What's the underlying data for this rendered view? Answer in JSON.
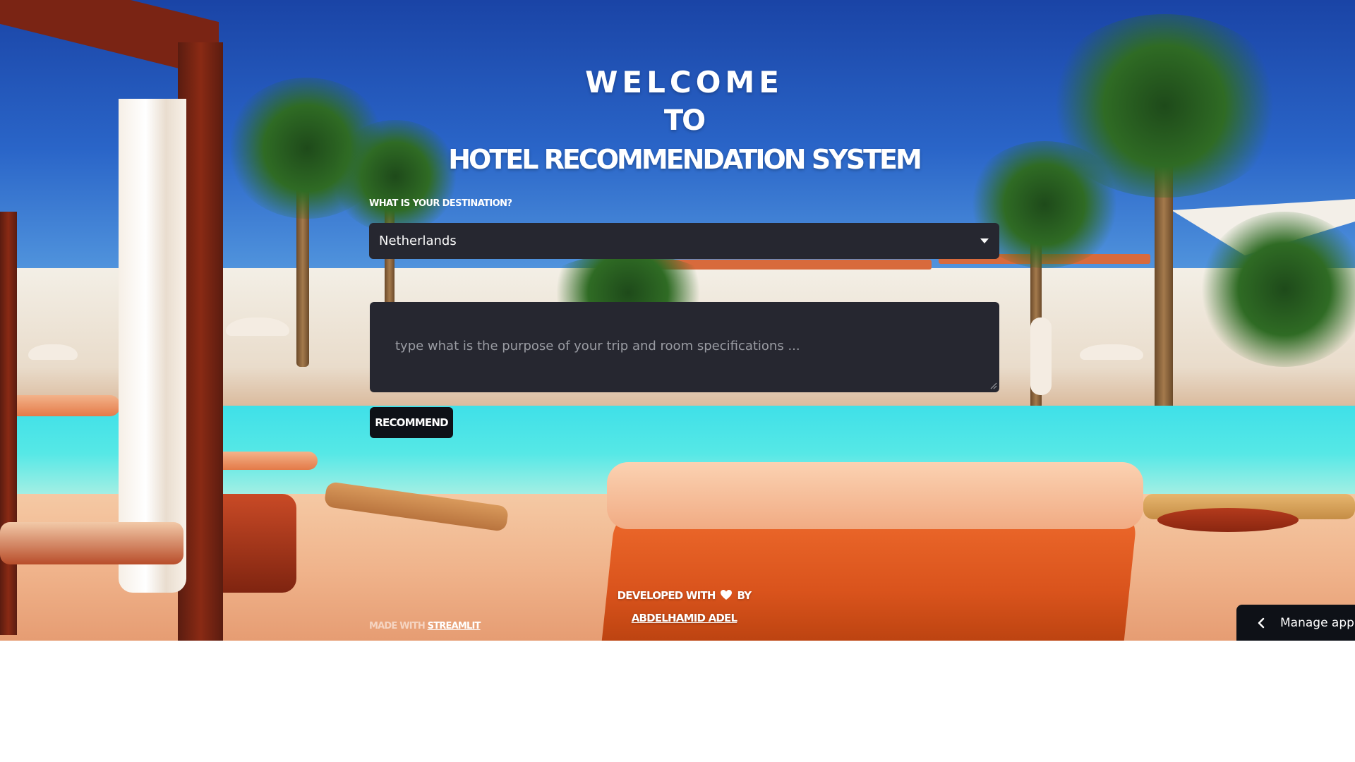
{
  "header": {
    "title_line1": "Welcome",
    "title_line2": "to",
    "title_line3": "Hotel Recommendation System"
  },
  "destination": {
    "label": "What is your destination?",
    "selected": "Netherlands",
    "icon": "caret-down-icon"
  },
  "trip_input": {
    "value": "",
    "placeholder": "type what is the purpose of your trip and room specifications ..."
  },
  "actions": {
    "recommend_label": "Recommend"
  },
  "footer": {
    "developed_prefix": "Developed with",
    "developed_suffix": "by",
    "heart_icon": "heart-icon",
    "author": "Abdelhamid Adel",
    "made_with_prefix": "Made with",
    "made_with_link": "Streamlit"
  },
  "manage_app": {
    "label": "Manage app",
    "icon": "chevron-left-icon"
  },
  "colors": {
    "input_bg": "#262730",
    "button_bg": "#0e1117",
    "text": "#ffffff"
  }
}
